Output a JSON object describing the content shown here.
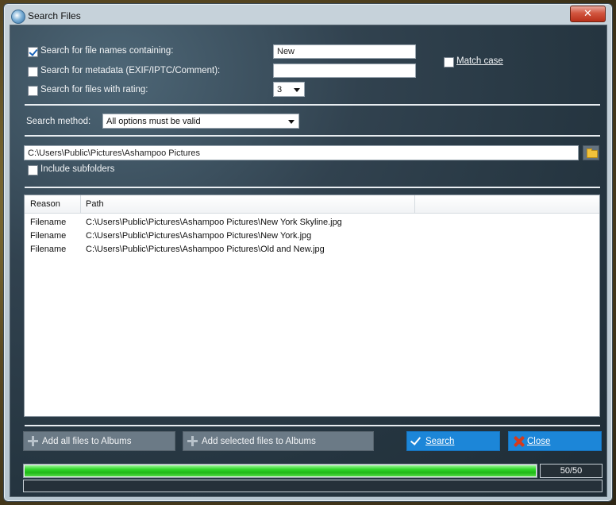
{
  "window": {
    "title": "Search Files",
    "close_label": "✕"
  },
  "options": {
    "filename": {
      "label": "Search for file names containing:",
      "checked": true,
      "value": "New"
    },
    "metadata": {
      "label": "Search for metadata (EXIF/IPTC/Comment):",
      "checked": false,
      "value": ""
    },
    "rating": {
      "label": "Search for files with rating:",
      "checked": false,
      "value": "3"
    },
    "match_case": {
      "label": "Match case",
      "checked": false
    }
  },
  "search_method": {
    "label": "Search method:",
    "value": "All options must be valid"
  },
  "folder": {
    "path": "C:\\Users\\Public\\Pictures\\Ashampoo Pictures",
    "include_subfolders_label": "Include subfolders",
    "include_subfolders_checked": false
  },
  "results": {
    "columns": [
      "Reason",
      "Path"
    ],
    "rows": [
      {
        "reason": "Filename",
        "path": "C:\\Users\\Public\\Pictures\\Ashampoo Pictures\\New York Skyline.jpg"
      },
      {
        "reason": "Filename",
        "path": "C:\\Users\\Public\\Pictures\\Ashampoo Pictures\\New York.jpg"
      },
      {
        "reason": "Filename",
        "path": "C:\\Users\\Public\\Pictures\\Ashampoo Pictures\\Old and New.jpg"
      }
    ]
  },
  "buttons": {
    "add_all": "Add all files to Albums",
    "add_selected": "Add selected files to Albums",
    "search": "Search",
    "close": "Close"
  },
  "progress": {
    "fraction": 1.0,
    "count_text": "50/50"
  },
  "colors": {
    "accent": "#1c86d8",
    "progress_green": "#33d92c",
    "panel_dark": "#2b3b47"
  }
}
